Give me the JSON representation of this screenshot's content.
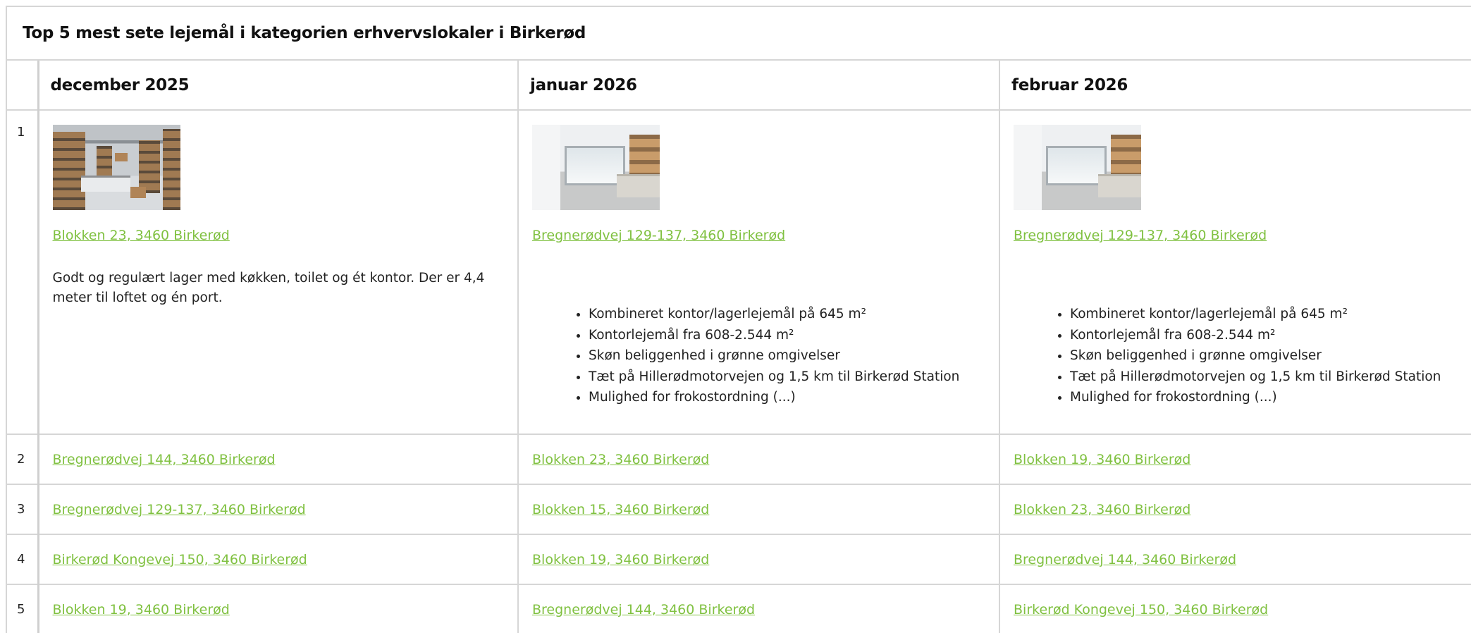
{
  "caption": "Top 5 mest sete lejemål i kategorien erhvervslokaler i Birkerød",
  "headers": {
    "num": "",
    "col1": "december 2025",
    "col2": "januar 2026",
    "col3": "februar 2026"
  },
  "colors": {
    "link": "#80c141",
    "border": "#d6d6d6"
  },
  "rows": [
    {
      "rank": "1",
      "cells": [
        {
          "image": "warehouse-photo",
          "address": "Blokken 23, 3460 Birkerød",
          "description": "Godt og regulært lager med køkken, toilet og ét kontor. Der er 4,4 meter til loftet og én port."
        },
        {
          "image": "office-room-photo",
          "address": "Bregnerødvej 129-137, 3460 Birkerød",
          "bullets": [
            "Kombineret kontor/lagerlejemål på 645 m²",
            "Kontorlejemål fra 608-2.544 m²",
            "Skøn beliggenhed i grønne omgivelser",
            "Tæt på Hillerødmotorvejen og 1,5 km til Birkerød Station",
            "Mulighed for frokostordning (...)"
          ]
        },
        {
          "image": "office-room-photo",
          "address": "Bregnerødvej 129-137, 3460 Birkerød",
          "bullets": [
            "Kombineret kontor/lagerlejemål på 645 m²",
            "Kontorlejemål fra 608-2.544 m²",
            "Skøn beliggenhed i grønne omgivelser",
            "Tæt på Hillerødmotorvejen og 1,5 km til Birkerød Station",
            "Mulighed for frokostordning (...)"
          ]
        }
      ]
    },
    {
      "rank": "2",
      "cells": [
        "Bregnerødvej 144, 3460 Birkerød",
        "Blokken 23, 3460 Birkerød",
        "Blokken 19, 3460 Birkerød"
      ]
    },
    {
      "rank": "3",
      "cells": [
        "Bregnerødvej 129-137, 3460 Birkerød",
        "Blokken 15, 3460 Birkerød",
        "Blokken 23, 3460 Birkerød"
      ]
    },
    {
      "rank": "4",
      "cells": [
        "Birkerød Kongevej 150, 3460 Birkerød",
        "Blokken 19, 3460 Birkerød",
        "Bregnerødvej 144, 3460 Birkerød"
      ]
    },
    {
      "rank": "5",
      "cells": [
        "Blokken 19, 3460 Birkerød",
        "Bregnerødvej 144, 3460 Birkerød",
        "Birkerød Kongevej 150, 3460 Birkerød"
      ]
    }
  ]
}
